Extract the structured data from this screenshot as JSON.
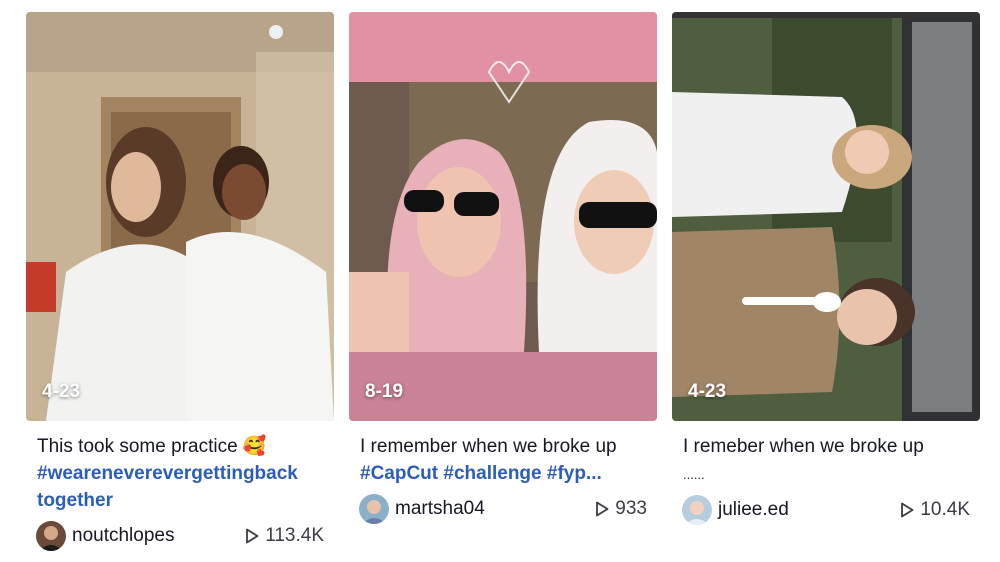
{
  "cards": [
    {
      "date": "4-23",
      "caption_text": "This took some practice",
      "caption_emoji": "🥰",
      "hashtags": [
        "#weareneverevergettingback",
        "together"
      ],
      "author": "noutchlopes",
      "views": "113.4K"
    },
    {
      "date": "8-19",
      "caption_text": "I remember when we broke up",
      "hashtags_line": "#CapCut #challenge #fyp...",
      "author": "martsha04",
      "views": "933"
    },
    {
      "date": "4-23",
      "caption_text": "I remeber when we broke up",
      "caption_extra": "......",
      "author": "juliee.ed",
      "views": "10.4K"
    }
  ],
  "colors": {
    "hashtag": "#2b5db9",
    "text": "#161823",
    "muted": "#3b3c44"
  }
}
